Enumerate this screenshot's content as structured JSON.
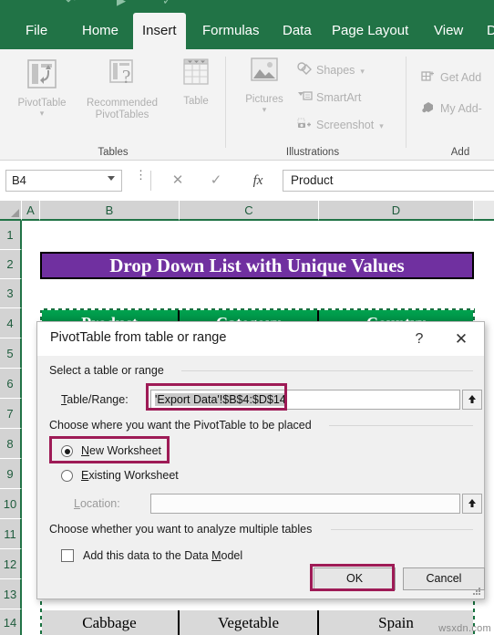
{
  "app": {
    "accent_green": "#217346",
    "ribbon_bg": "#f3f3f3",
    "highlight_color": "#9E1B56",
    "banner_color": "#7030A0",
    "header_green": "#008542",
    "watermark": "wsxdn.com"
  },
  "quick_access": [
    {
      "name": "undo-icon",
      "glyph": "↶"
    },
    {
      "name": "redo-icon",
      "glyph": "↷"
    },
    {
      "name": "autosave-icon",
      "glyph": "✓"
    }
  ],
  "tabs": [
    {
      "label": "File",
      "active": false
    },
    {
      "label": "Home",
      "active": false
    },
    {
      "label": "Insert",
      "active": true
    },
    {
      "label": "Formulas",
      "active": false
    },
    {
      "label": "Data",
      "active": false
    },
    {
      "label": "Page Layout",
      "active": false
    },
    {
      "label": "View",
      "active": false
    },
    {
      "label": "D",
      "active": false
    }
  ],
  "ribbon": {
    "groups": [
      {
        "label": "Tables"
      },
      {
        "label": "Illustrations"
      },
      {
        "label": "Add"
      }
    ],
    "tables": {
      "pivottable": "PivotTable",
      "recommended_line1": "Recommended",
      "recommended_line2": "PivotTables",
      "table": "Table"
    },
    "illustrations": {
      "pictures": "Pictures",
      "shapes": "Shapes",
      "smartart": "SmartArt",
      "screenshot": "Screenshot"
    },
    "addins": {
      "get_addins": "Get Add",
      "my_addins": "My Add-"
    }
  },
  "formula_bar": {
    "name_box": "B4",
    "cancel_icon": "✕",
    "enter_icon": "✓",
    "fx_icon": "fx",
    "formula": "Product"
  },
  "grid": {
    "columns": [
      "A",
      "B",
      "C",
      "D"
    ],
    "rows": [
      "1",
      "2",
      "3",
      "4",
      "5",
      "6",
      "7",
      "8",
      "9",
      "10",
      "11",
      "12",
      "13",
      "14"
    ],
    "banner_text": "Drop Down List with Unique Values",
    "headers": [
      "Product",
      "Category",
      "Country"
    ],
    "last_row": [
      "Cabbage",
      "Vegetable",
      "Spain"
    ]
  },
  "dialog": {
    "title": "PivotTable from table or range",
    "help_icon": "?",
    "close_icon": "✕",
    "section_source": "Select a table or range",
    "table_range_label": "Table/Range:",
    "table_range_value": "'Export Data'!$B$4:$D$14",
    "range_picker_icon": "⬆",
    "section_placement": "Choose where you want the PivotTable to be placed",
    "radio_new": "New Worksheet",
    "radio_existing": "Existing Worksheet",
    "radio_selected": "New Worksheet",
    "location_label": "Location:",
    "location_value": "",
    "location_picker_icon": "⬆",
    "section_multiple": "Choose whether you want to analyze multiple tables",
    "checkbox_data_model": "Add this data to the Data Model",
    "checkbox_checked": false,
    "ok_label": "OK",
    "cancel_label": "Cancel"
  }
}
